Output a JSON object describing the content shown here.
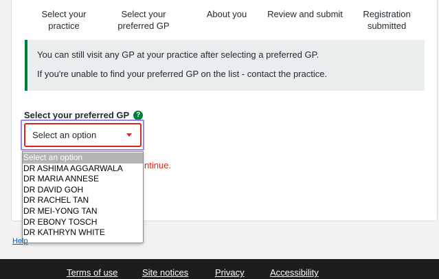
{
  "steps": [
    {
      "label": "Select your practice"
    },
    {
      "label": "Select your preferred GP"
    },
    {
      "label": "About you"
    },
    {
      "label": "Review and submit"
    },
    {
      "label": "Registration submitted"
    }
  ],
  "inset": {
    "line1": "You can still visit any GP at your practice after selecting a preferred GP.",
    "line2": "If you're unable to find your preferred GP on the list - contact the practice."
  },
  "field": {
    "label": "Select your preferred GP",
    "help_icon": "?",
    "selected_value": "Select an option",
    "error_fragment": "ntinue."
  },
  "dropdown": {
    "options": [
      "Select an option",
      "DR ASHIMA AGGARWALA",
      "DR MARIA ANNESE",
      "DR DAVID GOH",
      "DR RACHEL TAN",
      "DR MEI-YONG TAN",
      "DR EBONY TOSCH",
      "DR KATHRYN WHITE"
    ]
  },
  "help_link": "Help",
  "footer": {
    "links": [
      "Terms of use",
      "Site notices",
      "Privacy",
      "Accessibility"
    ]
  },
  "colors": {
    "accent_green": "#007f3b",
    "error_red": "#d5281b",
    "focus_purple": "#9e80f0",
    "footer_bg": "#1d1d1d"
  }
}
